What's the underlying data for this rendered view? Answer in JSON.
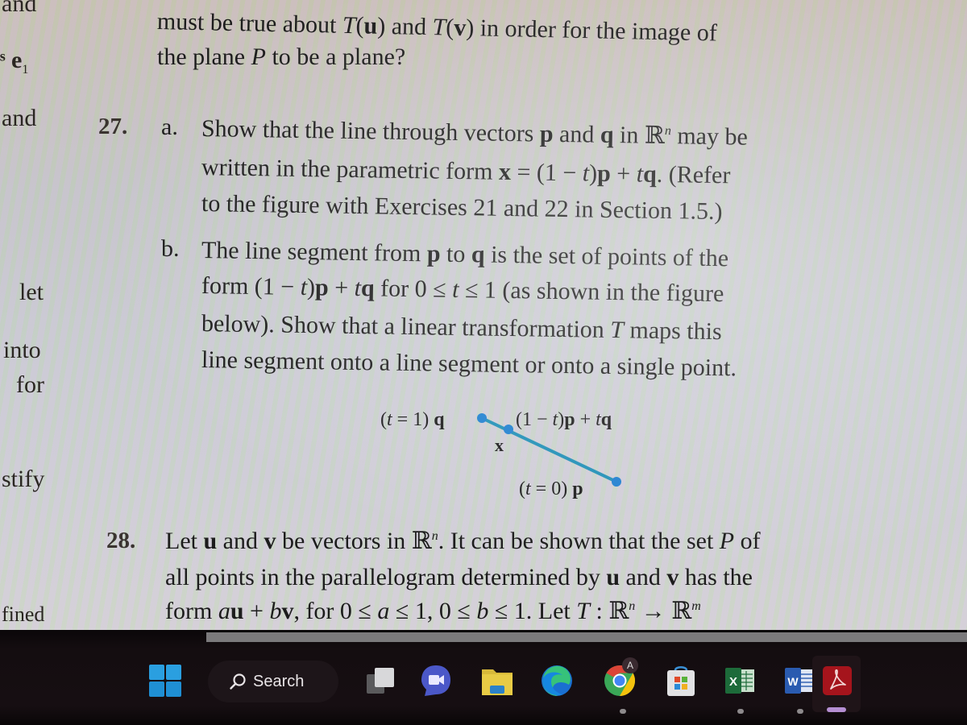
{
  "document": {
    "margin_fragments": [
      "and",
      "e",
      "1",
      "and",
      "let",
      "into",
      "for",
      "stify",
      "-",
      "fined"
    ],
    "intro_line1": {
      "pre": "must be true about ",
      "T1": "T",
      "u": "u",
      "mid": " and ",
      "T2": "T",
      "v": "v",
      "post": " in order for the image of"
    },
    "intro_line2": {
      "pre": "the plane ",
      "P": "P",
      "post": " to be a plane?"
    },
    "ex27": {
      "number": "27.",
      "a_label": "a.",
      "a_line1": {
        "pre": "Show that the line through vectors ",
        "p": "p",
        "mid": " and ",
        "q": "q",
        "in": " in ",
        "R": "ℝ",
        "n": "n",
        "post": " may be"
      },
      "a_line2": {
        "pre": "written in the parametric form ",
        "x": "x",
        "eq": " = (1 − ",
        "t": "t",
        "close": ")",
        "p": "p",
        "plus": " + ",
        "t2": "t",
        "q": "q",
        "post": ". (Refer"
      },
      "a_line3": "to the figure with Exercises 21 and 22 in Section 1.5.)",
      "b_label": "b.",
      "b_line1": {
        "pre": "The line segment from ",
        "p": "p",
        "mid": " to ",
        "q": "q",
        "post": " is the set of points of the"
      },
      "b_line2": {
        "pre": "form (1 − ",
        "t": "t",
        "close": ")",
        "p": "p",
        "plus": " + ",
        "t2": "t",
        "q": "q",
        "for": " for 0 ≤ ",
        "t3": "t",
        "post": " ≤ 1 (as shown in the figure"
      },
      "b_line3": {
        "pre": "below). Show that a linear transformation ",
        "T": "T",
        "post": " maps this"
      },
      "b_line4": "line segment onto a line segment or onto a single point."
    },
    "figure": {
      "label_q": {
        "pre": "(",
        "t": "t",
        "post": " = 1) ",
        "q": "q"
      },
      "label_x": "x",
      "label_mid": {
        "pre": "(1 − ",
        "t": "t",
        "close": ")",
        "p": "p",
        "plus": " + ",
        "t2": "t",
        "q": "q"
      },
      "label_p": {
        "pre": "(",
        "t": "t",
        "post": " = 0) ",
        "p": "p"
      },
      "line_color": "#1f8fb6",
      "point_color": "#1e7fd0"
    },
    "ex28": {
      "number": "28.",
      "line1": {
        "pre": "Let ",
        "u": "u",
        "mid": " and ",
        "v": "v",
        "mid2": " be vectors in ",
        "R": "ℝ",
        "n": "n",
        "mid3": ". It can be shown that the set ",
        "P": "P",
        "post": " of"
      },
      "line2": {
        "pre": "all points in the parallelogram determined by ",
        "u": "u",
        "mid": " and ",
        "v": "v",
        "post": " has the"
      },
      "line3": {
        "pre": "form ",
        "a": "a",
        "u": "u",
        "plus": " + ",
        "b": "b",
        "v": "v",
        "mid": ", for 0 ≤ ",
        "a2": "a",
        "mid2": " ≤ 1, 0 ≤ ",
        "b2": "b",
        "mid3": " ≤ 1. Let ",
        "T": "T",
        "colon": " : ",
        "R1": "ℝ",
        "n": "n",
        "arrow": " → ",
        "R2": "ℝ",
        "m": "m"
      }
    }
  },
  "taskbar": {
    "search_label": "Search",
    "apps": [
      {
        "name": "Start",
        "icon": "windows-start-icon"
      },
      {
        "name": "Task View",
        "icon": "task-view-icon"
      },
      {
        "name": "Meet",
        "icon": "video-chat-icon"
      },
      {
        "name": "File Explorer",
        "icon": "folder-icon"
      },
      {
        "name": "Microsoft Edge",
        "icon": "edge-icon"
      },
      {
        "name": "Google Chrome",
        "icon": "chrome-icon",
        "badge": "A",
        "running": true
      },
      {
        "name": "Microsoft Store",
        "icon": "store-icon"
      },
      {
        "name": "Excel",
        "icon": "excel-icon",
        "letter": "X",
        "running": true
      },
      {
        "name": "Word",
        "icon": "word-icon",
        "letter": "W",
        "running": true
      },
      {
        "name": "Adobe Acrobat",
        "icon": "acrobat-icon",
        "active": true
      }
    ]
  }
}
